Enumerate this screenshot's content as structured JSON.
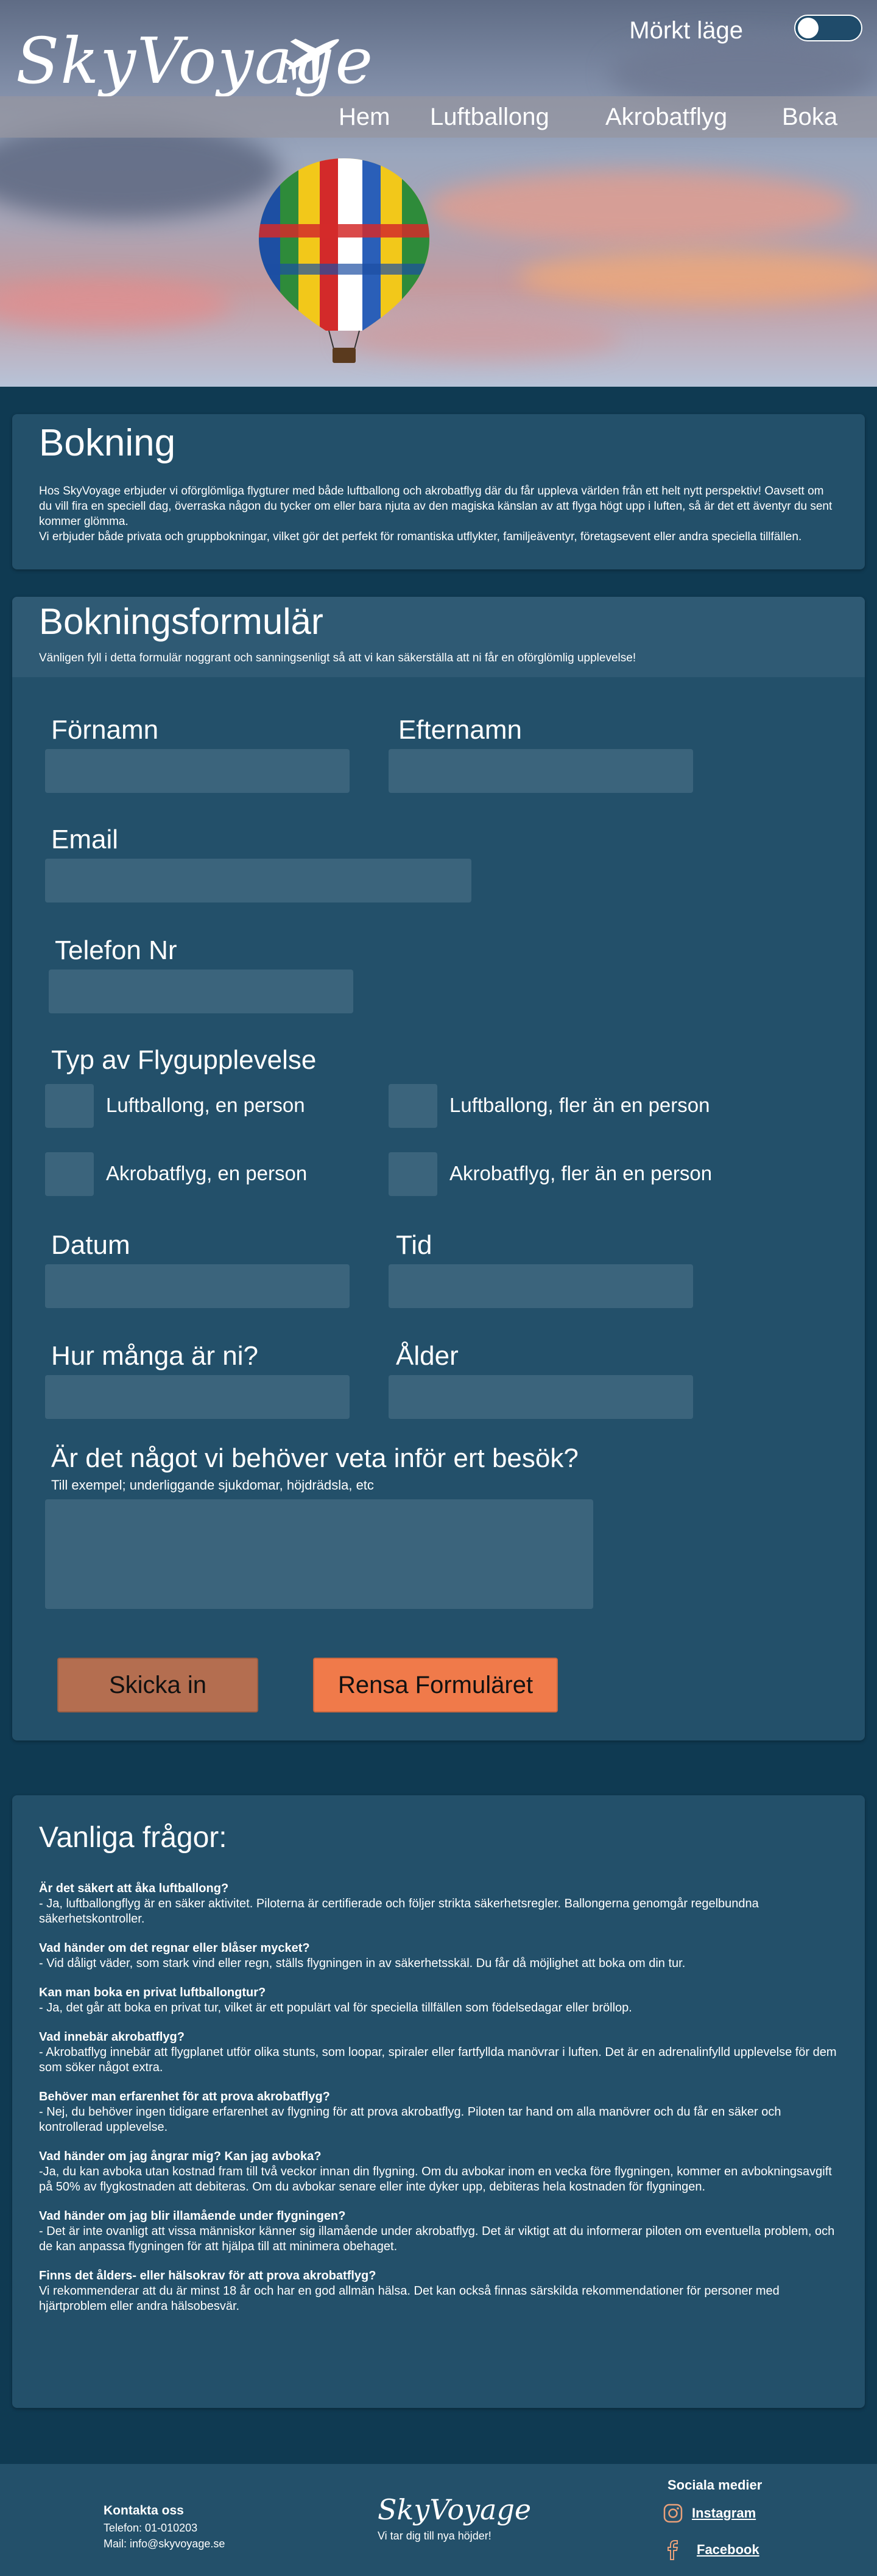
{
  "header": {
    "logo": "SkyVoyage",
    "mode_label": "Mörkt läge",
    "nav": [
      "Hem",
      "Luftballong",
      "Akrobatflyg",
      "Boka"
    ]
  },
  "booking": {
    "title": "Bokning",
    "p1": "Hos SkyVoyage erbjuder vi oförglömliga flygturer med både luftballong och akrobatflyg där du får uppleva världen från ett helt nytt perspektiv! Oavsett om du vill fira en speciell dag, överraska någon du tycker om eller bara njuta av den magiska känslan av att flyga högt upp i luften, så är det ett äventyr du sent kommer glömma.",
    "p2": "Vi erbjuder både privata och gruppbokningar, vilket gör det perfekt för romantiska utflykter, familjeäventyr, företagsevent eller andra speciella tillfällen."
  },
  "form": {
    "title": "Bokningsformulär",
    "intro": "Vänligen fyll i detta formulär noggrant och sanningsenligt så att vi kan säkerställa att ni får en oförglömlig upplevelse!",
    "first_name": "Förnamn",
    "last_name": "Efternamn",
    "email": "Email",
    "phone": "Telefon Nr",
    "type_label": "Typ av Flygupplevelse",
    "options": [
      "Luftballong, en person",
      "Luftballong, fler än en person",
      "Akrobatflyg, en person",
      "Akrobatflyg, fler än en person"
    ],
    "date": "Datum",
    "time": "Tid",
    "count": "Hur många är ni?",
    "age": "Ålder",
    "notes_label": "Är det något vi behöver veta inför ert besök?",
    "notes_hint": "Till exempel; underliggande sjukdomar, höjdrädsla, etc",
    "submit": "Skicka in",
    "reset": "Rensa Formuläret"
  },
  "faq": {
    "title": "Vanliga frågor:",
    "items": [
      {
        "q": "Är det säkert att åka luftballong?",
        "a": "- Ja, luftballongflyg är en säker aktivitet. Piloterna är certifierade och följer strikta säkerhetsregler. Ballongerna genomgår regelbundna säkerhetskontroller."
      },
      {
        "q": "Vad händer om det regnar eller blåser mycket?",
        "a": "- Vid dåligt väder, som stark vind eller regn, ställs flygningen in av säkerhetsskäl. Du får då möjlighet att boka om din tur."
      },
      {
        "q": "Kan man boka en privat luftballongtur?",
        "a": "- Ja, det går att boka en privat tur, vilket är ett populärt val för speciella tillfällen som födelsedagar eller bröllop."
      },
      {
        "q": "Vad innebär akrobatflyg?",
        "a": "- Akrobatflyg innebär att flygplanet utför olika stunts, som loopar, spiraler eller fartfyllda manövrar i luften. Det är en adrenalinfylld upplevelse för dem som söker något extra."
      },
      {
        "q": "Behöver man erfarenhet för att prova akrobatflyg?",
        "a": "- Nej, du behöver ingen tidigare erfarenhet av flygning för att prova akrobatflyg. Piloten tar hand om alla manövrer och du får en säker och kontrollerad upplevelse."
      },
      {
        "q": "Vad händer om jag ångrar mig? Kan jag avboka?",
        "a": "-Ja, du kan avboka utan kostnad fram till två veckor innan din flygning. Om du avbokar inom en vecka före flygningen, kommer en avbokningsavgift på 50% av flygkostnaden att debiteras. Om du avbokar senare eller inte dyker upp, debiteras hela kostnaden för flygningen."
      },
      {
        "q": "Vad händer om jag blir illamående under flygningen?",
        "a": "- Det är inte ovanligt att vissa människor känner sig illamående under akrobatflyg. Det är viktigt att du informerar piloten om eventuella problem, och de kan anpassa flygningen för att hjälpa till att minimera obehaget."
      },
      {
        "q": "Finns det ålders- eller hälsokrav för att prova akrobatflyg?",
        "a": "Vi rekommenderar att du är minst 18 år och har en god allmän hälsa. Det kan också finnas särskilda rekommendationer för personer med hjärtproblem eller andra hälsobesvär."
      }
    ]
  },
  "footer": {
    "contact_title": "Kontakta oss",
    "phone": "Telefon: 01-010203",
    "email": "Mail: info@skyvoyage.se",
    "logo": "SkyVoyage",
    "tagline": "Vi tar dig till nya höjder!",
    "social_title": "Sociala medier",
    "instagram": "Instagram",
    "facebook": "Facebook"
  },
  "colors": {
    "page_bg": "#0f3a52",
    "card_bg": "#23506a",
    "field_bg": "#3b647c",
    "submit_bg": "#b46e50",
    "reset_bg": "#f07a4a"
  },
  "icons": [
    "airplane-icon",
    "instagram-icon",
    "facebook-icon"
  ]
}
